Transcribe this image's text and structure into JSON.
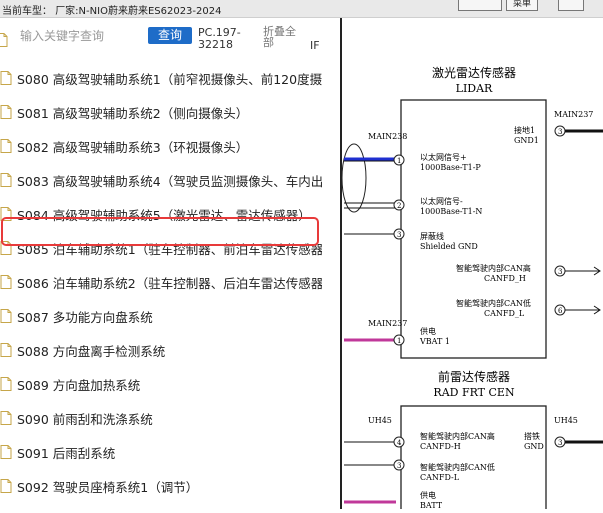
{
  "header": {
    "vehicle_label": "当前车型：",
    "vehicle_value": "厂家:N-NIO蔚来蔚来ES62023-2024",
    "menu_button": "菜单"
  },
  "search": {
    "placeholder": "输入关键字查询",
    "button_label": "查询",
    "pc_label": "PC.197-32218",
    "fold_label": "折叠全部",
    "if_label": "IF"
  },
  "list": {
    "items": [
      {
        "label": "S080 高级驾驶辅助系统1（前窄视摄像头、前120度摄"
      },
      {
        "label": "S081 高级驾驶辅助系统2（侧向摄像头）"
      },
      {
        "label": "S082 高级驾驶辅助系统3（环视摄像头）"
      },
      {
        "label": "S083 高级驾驶辅助系统4（驾驶员监测摄像头、车内出"
      },
      {
        "label": "S084 高级驾驶辅助系统5（激光雷达、雷达传感器）"
      },
      {
        "label": "S085 泊车辅助系统1（驻车控制器、前泊车雷达传感器"
      },
      {
        "label": "S086 泊车辅助系统2（驻车控制器、后泊车雷达传感器"
      },
      {
        "label": "S087 多功能方向盘系统"
      },
      {
        "label": "S088 方向盘离手检测系统"
      },
      {
        "label": "S089 方向盘加热系统"
      },
      {
        "label": "S090 前雨刮和洗涤系统"
      },
      {
        "label": "S091 后雨刮系统"
      },
      {
        "label": "S092 驾驶员座椅系统1（调节）"
      }
    ]
  },
  "diagram": {
    "lidar": {
      "title_cn": "激光雷达传感器",
      "title_en": "LIDAR",
      "pins_left": [
        {
          "num": "1",
          "cn": "以太网信号+",
          "en": "1000Base-T1-P"
        },
        {
          "num": "2",
          "cn": "以太网信号-",
          "en": "1000Base-T1-N"
        },
        {
          "num": "3",
          "cn": "屏蔽线",
          "en": "Shielded GND"
        },
        {
          "num": "1",
          "cn": "供电",
          "en": "VBAT 1"
        }
      ],
      "pins_right": [
        {
          "num": "3",
          "cn": "接地1",
          "en": "GND1"
        },
        {
          "num": "3",
          "cn": "智能驾驶内部CAN高",
          "en": "CANFD_H"
        },
        {
          "num": "6",
          "cn": "智能驾驶内部CAN低",
          "en": "CANFD_L"
        }
      ],
      "left_connector": "MAIN238",
      "left_power_connector": "MAIN237",
      "right_connector": "MAIN237"
    },
    "radar": {
      "title_cn": "前雷达传感器",
      "title_en": "RAD FRT CEN",
      "pins_left": [
        {
          "num": "4",
          "cn": "智能驾驶内部CAN高",
          "en": "CANFD-H"
        },
        {
          "num": "3",
          "cn": "智能驾驶内部CAN低",
          "en": "CANFD-L"
        },
        {
          "num": "",
          "cn": "供电",
          "en": "BATT"
        }
      ],
      "pins_right": [
        {
          "num": "3",
          "cn": "搭铁",
          "en": "GND"
        }
      ],
      "left_connector": "UH45",
      "right_connector": "UH45"
    },
    "colors": {
      "blue_wire": "#1f2fd0",
      "magenta_wire": "#c0389a",
      "black_wire": "#111111",
      "highlight_border": "#e83a3a",
      "query_button": "#1e6cc8"
    }
  }
}
